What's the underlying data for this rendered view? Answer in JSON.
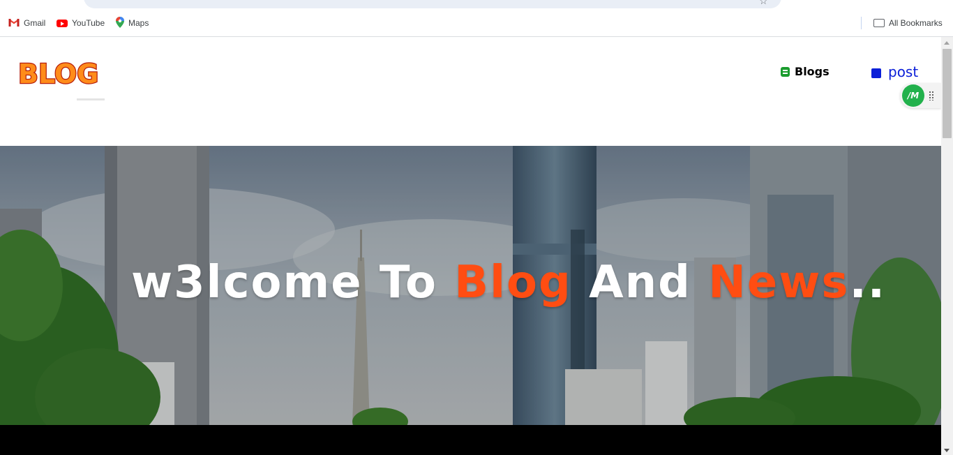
{
  "bookmarks": {
    "items": [
      {
        "label": "Gmail",
        "icon": "gmail-icon"
      },
      {
        "label": "YouTube",
        "icon": "youtube-icon"
      },
      {
        "label": "Maps",
        "icon": "maps-icon"
      }
    ],
    "all_bookmarks": {
      "label": "All Bookmarks",
      "icon": "folder-icon"
    }
  },
  "site": {
    "logo": {
      "text": "BLOG",
      "fill": "#ff8c1a",
      "outline": "#b51f0c"
    },
    "nav": {
      "blogs": {
        "label": "Blogs",
        "icon": "blogs-icon",
        "color": "#000000",
        "icon_color": "#1a9c2e"
      },
      "post": {
        "label": "post",
        "icon": "edit-icon",
        "color": "#0b1fd8"
      }
    },
    "extension": {
      "label": "/M",
      "color": "#22b14c"
    }
  },
  "hero": {
    "title_parts": {
      "part1": "w3lcome To ",
      "accent1": "Blog",
      "part2": " And ",
      "accent2": "News",
      "part3": ".."
    },
    "accent_color": "#ff4d12"
  }
}
